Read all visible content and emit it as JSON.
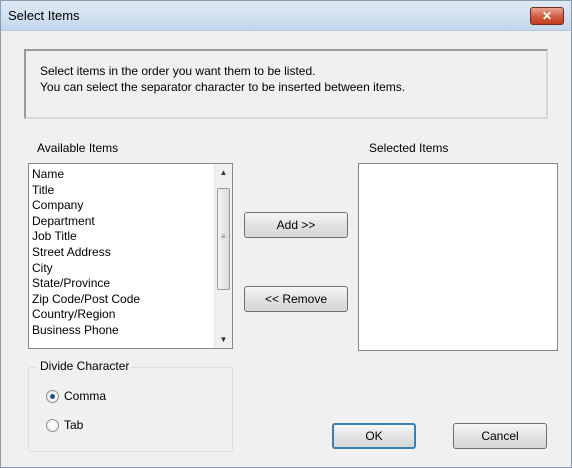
{
  "window": {
    "title": "Select Items",
    "close_glyph": "✕"
  },
  "instructions": {
    "line1": "Select items in the order you want them to be listed.",
    "line2": "You can select the separator character to be inserted between items."
  },
  "available": {
    "label": "Available Items",
    "items": [
      "Name",
      "Title",
      "Company",
      "Department",
      "Job Title",
      "Street Address",
      "City",
      "State/Province",
      "Zip Code/Post Code",
      "Country/Region",
      "Business Phone"
    ]
  },
  "selected": {
    "label": "Selected Items",
    "items": []
  },
  "buttons": {
    "add": "Add >>",
    "remove": "<< Remove",
    "ok": "OK",
    "cancel": "Cancel"
  },
  "divide": {
    "label": "Divide Character",
    "options": [
      {
        "label": "Comma",
        "checked": true
      },
      {
        "label": "Tab",
        "checked": false
      }
    ]
  },
  "icons": {
    "close": "close-icon",
    "scroll_up": "scroll-up-arrow-icon",
    "scroll_down": "scroll-down-arrow-icon"
  }
}
